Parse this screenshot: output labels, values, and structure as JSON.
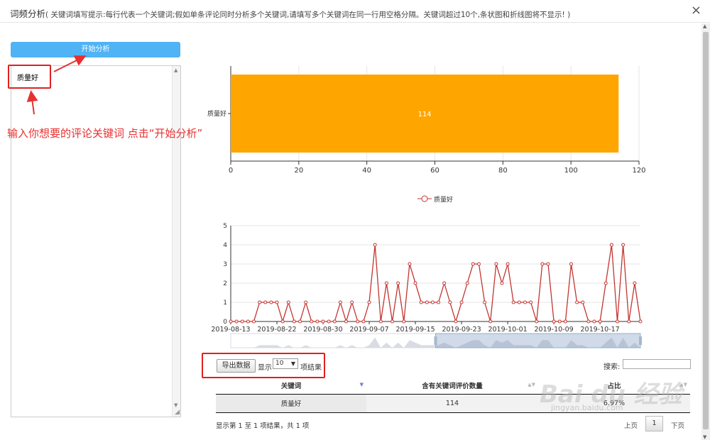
{
  "dialog": {
    "title": "词频分析",
    "hint": "( 关键词填写提示:每行代表一个关键词;假如单条评论同时分析多个关键词,请填写多个关键词在同一行用空格分隔。关键词超过10个,条状图和折线图将不显示! )",
    "close_symbol": "×"
  },
  "left": {
    "start_button": "开始分析",
    "keyword_text": "质量好",
    "annotation": "输入你想要的评论关键词 点击“开始分析”"
  },
  "colors": {
    "accent": "#4fb3f5",
    "bar": "#ffa500",
    "line": "#c23531",
    "annotation": "#e83030"
  },
  "chart_data": [
    {
      "type": "bar",
      "orientation": "horizontal",
      "categories": [
        "质量好"
      ],
      "values": [
        114
      ],
      "data_labels": [
        "114"
      ],
      "xlim": [
        0,
        120
      ],
      "xticks": [
        "0",
        "20",
        "40",
        "60",
        "80",
        "100",
        "120"
      ],
      "grid": true
    },
    {
      "type": "line",
      "series": [
        {
          "name": "质量好",
          "values": [
            0,
            0,
            0,
            0,
            0,
            1,
            1,
            1,
            1,
            0,
            1,
            0,
            0,
            1,
            0,
            0,
            0,
            0,
            0,
            1,
            0,
            1,
            0,
            0,
            1,
            4,
            0,
            2,
            0,
            2,
            0,
            3,
            2,
            1,
            1,
            1,
            1,
            2,
            1,
            0,
            1,
            2,
            3,
            3,
            1,
            0,
            3,
            2,
            3,
            1,
            1,
            1,
            1,
            0,
            3,
            3,
            0,
            0,
            0,
            3,
            1,
            1,
            0,
            0,
            0,
            2,
            4,
            0,
            4,
            0,
            2,
            0
          ]
        }
      ],
      "xticks": [
        "2019-08-13",
        "2019-08-22",
        "2019-08-30",
        "2019-09-07",
        "2019-09-15",
        "2019-09-23",
        "2019-10-01",
        "2019-10-09",
        "2019-10-17"
      ],
      "ylim": [
        0,
        5
      ],
      "yticks": [
        "0",
        "1",
        "2",
        "3",
        "4",
        "5"
      ],
      "legend": "top-center",
      "grid": true,
      "datazoom": true
    }
  ],
  "table": {
    "export_button": "导出数据",
    "show_label": "显示",
    "page_size": "10",
    "results_label": "项结果",
    "search_label": "搜索:",
    "headers": [
      "关键词",
      "含有关键词评价数量",
      "占比"
    ],
    "rows": [
      [
        "质量好",
        "114",
        "6.97%"
      ]
    ],
    "info": "显示第 1 至 1 项结果，共 1 项",
    "prev": "上页",
    "current_page": "1",
    "next": "下页"
  },
  "watermark": {
    "brand": "Bai du 经验",
    "url": "jingyan.baidu.com"
  }
}
